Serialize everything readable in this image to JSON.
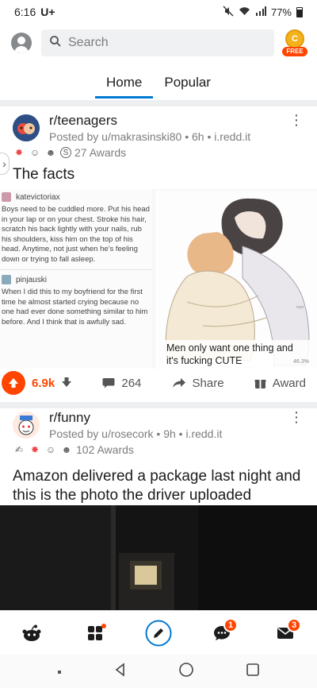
{
  "status_bar": {
    "time": "6:16",
    "carrier_icon": "U+",
    "battery": "77%"
  },
  "top_bar": {
    "search_placeholder": "Search",
    "coin_label": "FREE"
  },
  "tabs": [
    {
      "label": "Home",
      "active": true
    },
    {
      "label": "Popular",
      "active": false
    }
  ],
  "post1": {
    "subreddit": "r/teenagers",
    "byline": "Posted by u/makrasinski80 • 6h • i.redd.it",
    "awards_text": "27 Awards",
    "title": "The facts",
    "image": {
      "tweet1_user": "katevictoriax",
      "tweet1_text": "Boys need to be cuddled more. Put his head in your lap or on your chest. Stroke his hair, scratch his back lightly with your nails, rub his shoulders, kiss him on the top of his head. Anytime, not just when he's feeling down or trying to fall asleep.",
      "tweet2_user": "pinjauski",
      "tweet2_text": "When I did this to my boyfriend for the first time he almost started crying because no one had ever done something similar to him before. And I think that is awfully sad.",
      "caption": "Men only want one thing and it's fucking CUTE",
      "percent": "46.3%"
    },
    "actions": {
      "votes": "6.9k",
      "comments": "264",
      "share": "Share",
      "award": "Award"
    }
  },
  "post2": {
    "subreddit": "r/funny",
    "byline": "Posted by u/rosecork • 9h • i.redd.it",
    "awards_text": "102 Awards",
    "title": "Amazon delivered a package last night and this is the photo the driver uploaded"
  },
  "bottom_nav": {
    "chat_badge": "1",
    "inbox_badge": "3"
  },
  "colors": {
    "accent": "#0079d3",
    "upvote": "#ff4500"
  }
}
